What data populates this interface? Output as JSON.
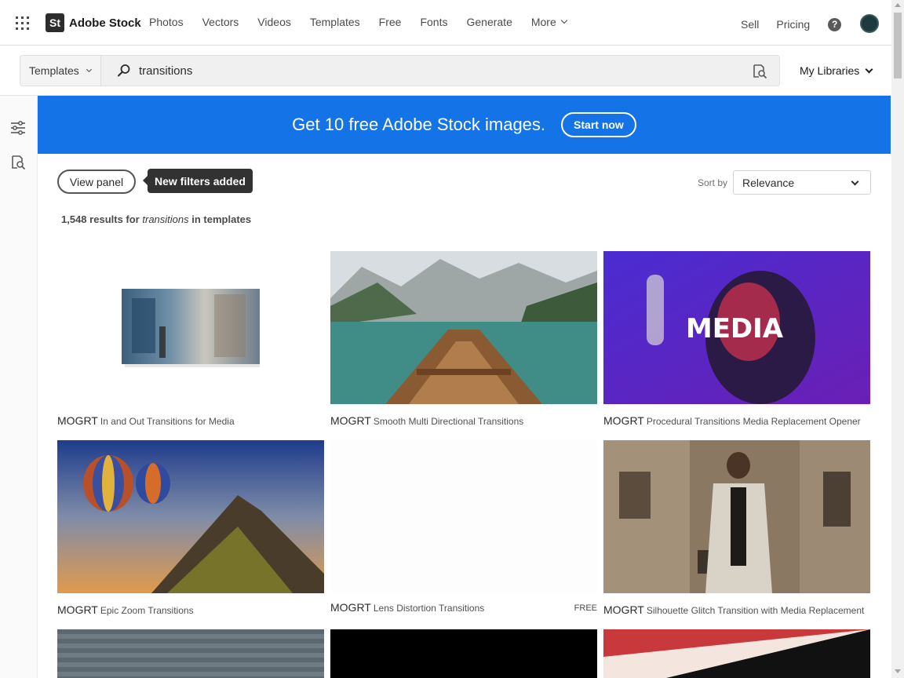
{
  "header": {
    "logo_badge": "St",
    "logo_text": "Adobe Stock",
    "nav": [
      "Photos",
      "Vectors",
      "Videos",
      "Templates",
      "Free",
      "Fonts",
      "Generate"
    ],
    "more_label": "More",
    "sell_label": "Sell",
    "pricing_label": "Pricing",
    "help_glyph": "?"
  },
  "search": {
    "type_value": "Templates",
    "query": "transitions",
    "my_libraries_label": "My Libraries"
  },
  "banner": {
    "text": "Get 10 free Adobe Stock images.",
    "button": "Start now",
    "color": "#1473e6"
  },
  "controls": {
    "view_panel_label": "View panel",
    "tooltip": "New filters added",
    "sort_label": "Sort by",
    "sort_value": "Relevance"
  },
  "results": {
    "count": "1,548",
    "text_mid": "results for",
    "term": "transitions",
    "text_end": "in templates"
  },
  "items": [
    {
      "kind": "MOGRT",
      "title": "In and Out Transitions for Media",
      "free": ""
    },
    {
      "kind": "MOGRT",
      "title": "Smooth Multi Directional Transitions",
      "free": ""
    },
    {
      "kind": "MOGRT",
      "title": "Procedural Transitions Media Replacement Opener",
      "free": ""
    },
    {
      "kind": "MOGRT",
      "title": "Epic Zoom Transitions",
      "free": ""
    },
    {
      "kind": "MOGRT",
      "title": "Lens Distortion Transitions",
      "free": "FREE"
    },
    {
      "kind": "MOGRT",
      "title": "Silhouette Glitch Transition with Media Replacement",
      "free": ""
    }
  ],
  "thumb_texts": {
    "media": "MEDIA"
  }
}
